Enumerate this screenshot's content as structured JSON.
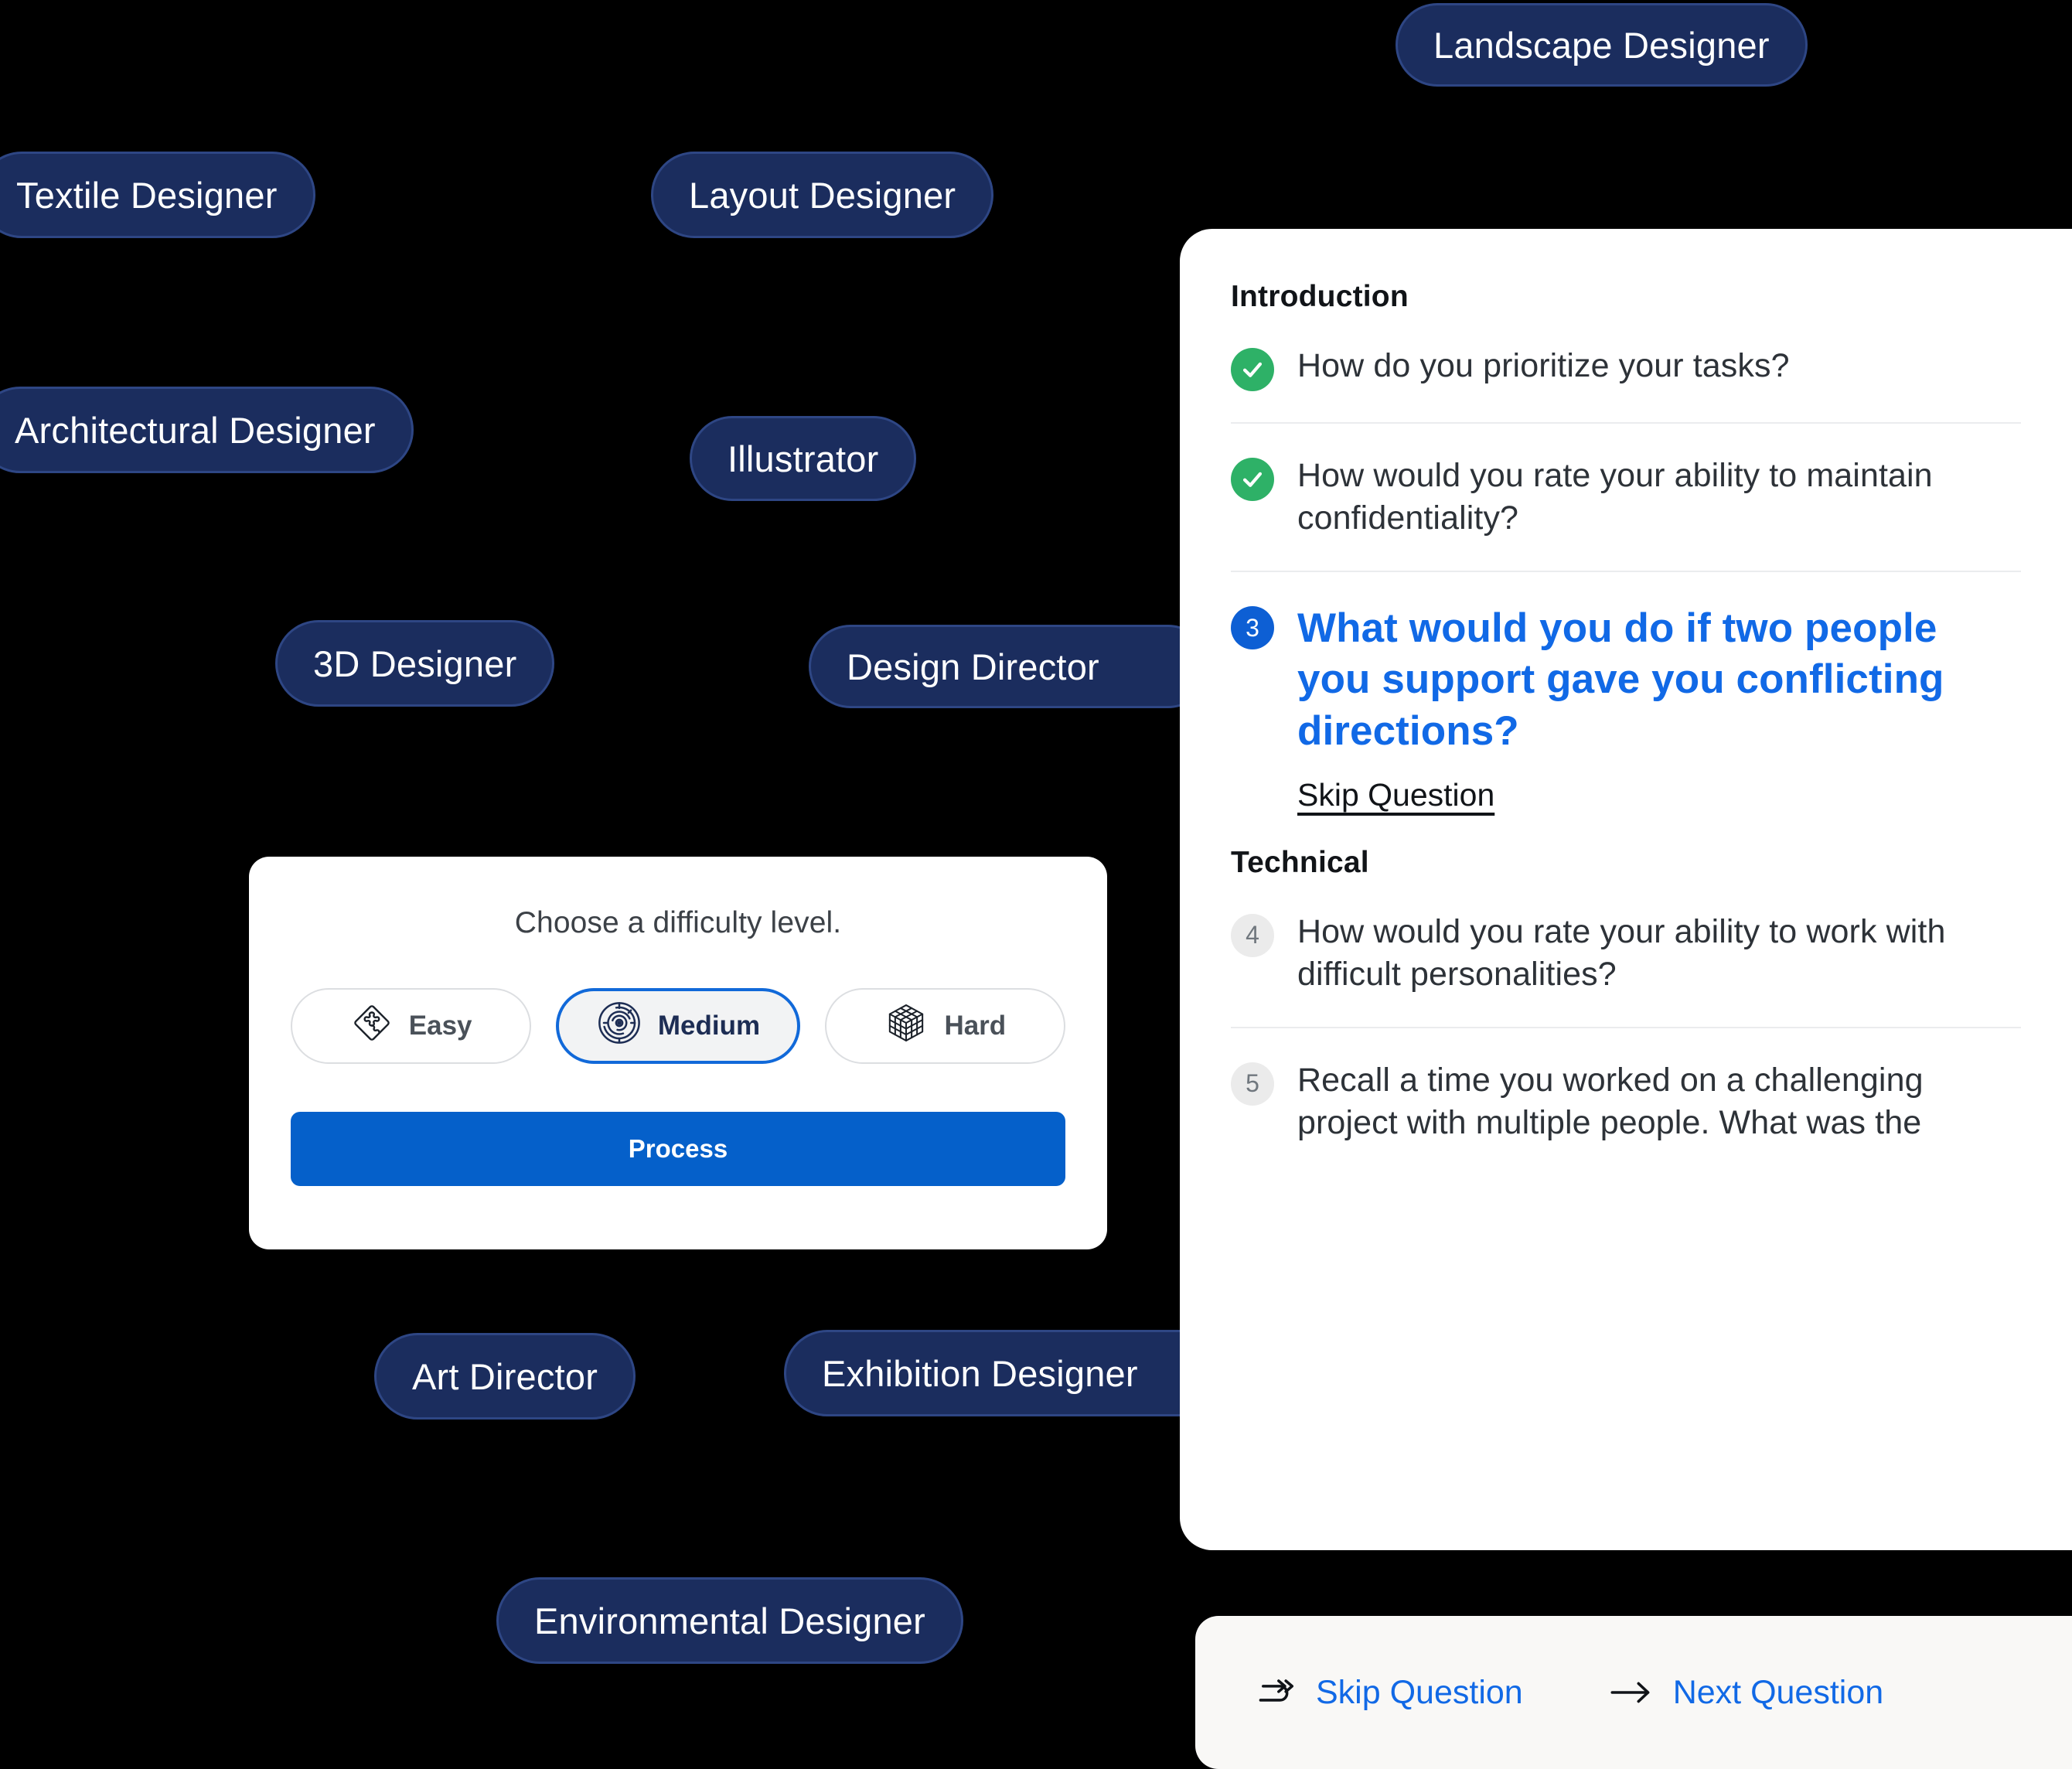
{
  "canvas": {
    "background": "#000000",
    "pill_fill": "#1b2d5e",
    "pill_border": "#2e4684",
    "accent_blue": "#1169e6",
    "button_blue": "#0560ca",
    "badge_blue": "#0d5fd4",
    "success_green": "#2eb167"
  },
  "job_pills": [
    {
      "label": "Landscape Designer"
    },
    {
      "label": "Textile Designer"
    },
    {
      "label": "Layout Designer"
    },
    {
      "label": "Architectural Designer"
    },
    {
      "label": "Illustrator"
    },
    {
      "label": "3D Designer"
    },
    {
      "label": "Design Director"
    },
    {
      "label": "Art Director"
    },
    {
      "label": "Exhibition Designer"
    },
    {
      "label": "Environmental Designer"
    }
  ],
  "difficulty_card": {
    "title": "Choose a difficulty level.",
    "levels": [
      {
        "label": "Easy",
        "icon": "puzzle-diamond-icon",
        "selected": false
      },
      {
        "label": "Medium",
        "icon": "circular-maze-icon",
        "selected": true
      },
      {
        "label": "Hard",
        "icon": "rubiks-cube-icon",
        "selected": false
      }
    ],
    "process_label": "Process"
  },
  "question_panel": {
    "sections": [
      {
        "heading": "Introduction",
        "questions": [
          {
            "number": "1",
            "state": "done",
            "text": "How do you prioritize your tasks?"
          },
          {
            "number": "2",
            "state": "done",
            "text": "How would you rate your ability to maintain confidentiality?"
          },
          {
            "number": "3",
            "state": "active",
            "text": "What would you do if two people you support gave you conflicting directions?",
            "skip_label": "Skip Question"
          }
        ]
      },
      {
        "heading": "Technical",
        "questions": [
          {
            "number": "4",
            "state": "pending",
            "text": "How would you rate your ability to work with difficult personalities?"
          },
          {
            "number": "5",
            "state": "pending",
            "text": "Recall a time you worked on a challenging project with multiple people. What was the"
          }
        ]
      }
    ]
  },
  "action_bar": {
    "skip_label": "Skip Question",
    "skip_icon": "redo-arrow-icon",
    "next_label": "Next Question",
    "next_icon": "arrow-right-icon"
  }
}
